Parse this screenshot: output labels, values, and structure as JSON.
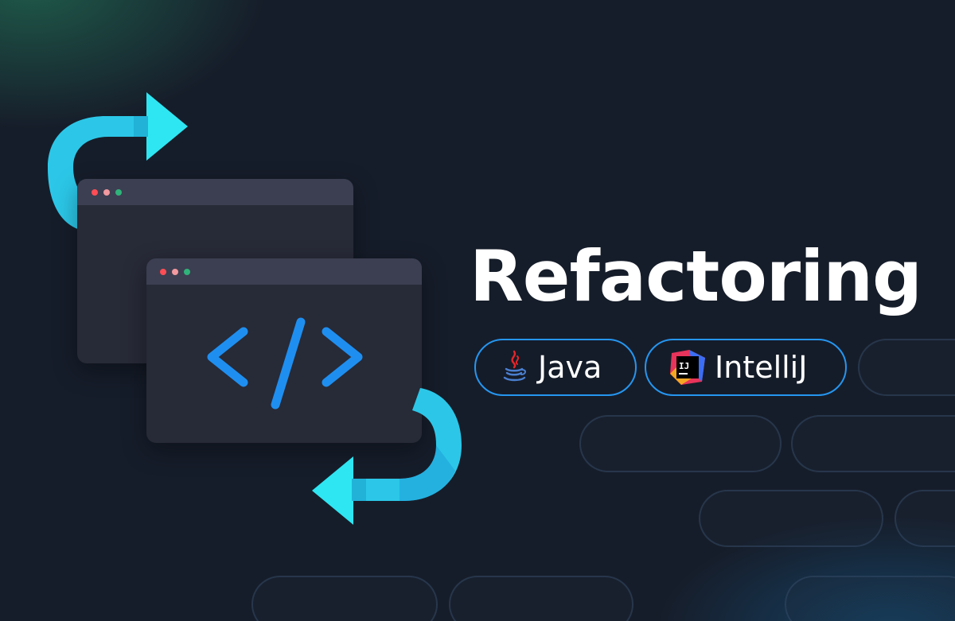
{
  "title": "Refactoring",
  "tags": [
    {
      "label": "Java",
      "icon": "java-icon"
    },
    {
      "label": "IntelliJ",
      "icon": "intellij-icon"
    }
  ],
  "intellij_logo_text": "IJ",
  "colors": {
    "background": "#161d2a",
    "accent_blue": "#2596f0",
    "arrow_cyan": "#2ee6f2",
    "window_body": "#272a37",
    "window_titlebar": "#3c3f51"
  }
}
